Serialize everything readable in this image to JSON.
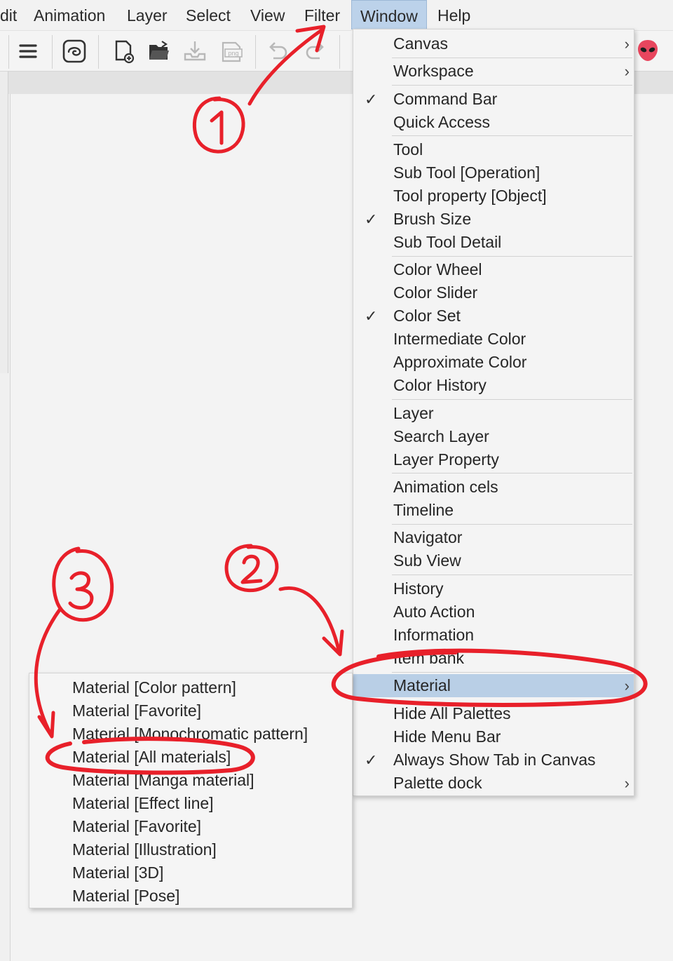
{
  "menubar": {
    "items": [
      "dit",
      "Animation",
      "Layer",
      "Select",
      "View",
      "Filter",
      "Window",
      "Help"
    ],
    "active": "Window"
  },
  "toolbar": {
    "icons": [
      "hamburger-menu-icon",
      "clip-studio-logo-icon",
      "new-canvas-icon",
      "open-folder-icon",
      "save-icon",
      "export-png-icon",
      "undo-icon",
      "redo-icon"
    ],
    "png_label": "png"
  },
  "window_menu": {
    "items": [
      {
        "label": "Canvas",
        "checked": false,
        "submenu": true
      },
      {
        "label": "Workspace",
        "checked": false,
        "submenu": true
      },
      {
        "label": "Command Bar",
        "checked": true,
        "submenu": false
      },
      {
        "label": "Quick Access",
        "checked": false,
        "submenu": false
      },
      {
        "label": "Tool",
        "checked": false,
        "submenu": false
      },
      {
        "label": "Sub Tool [Operation]",
        "checked": false,
        "submenu": false
      },
      {
        "label": "Tool property [Object]",
        "checked": false,
        "submenu": false
      },
      {
        "label": "Brush Size",
        "checked": true,
        "submenu": false
      },
      {
        "label": "Sub Tool Detail",
        "checked": false,
        "submenu": false
      },
      {
        "label": "Color Wheel",
        "checked": false,
        "submenu": false
      },
      {
        "label": "Color Slider",
        "checked": false,
        "submenu": false
      },
      {
        "label": "Color Set",
        "checked": true,
        "submenu": false
      },
      {
        "label": "Intermediate Color",
        "checked": false,
        "submenu": false
      },
      {
        "label": "Approximate Color",
        "checked": false,
        "submenu": false
      },
      {
        "label": "Color History",
        "checked": false,
        "submenu": false
      },
      {
        "label": "Layer",
        "checked": false,
        "submenu": false
      },
      {
        "label": "Search Layer",
        "checked": false,
        "submenu": false
      },
      {
        "label": "Layer Property",
        "checked": false,
        "submenu": false
      },
      {
        "label": "Animation cels",
        "checked": false,
        "submenu": false
      },
      {
        "label": "Timeline",
        "checked": false,
        "submenu": false
      },
      {
        "label": "Navigator",
        "checked": false,
        "submenu": false
      },
      {
        "label": "Sub View",
        "checked": false,
        "submenu": false
      },
      {
        "label": "History",
        "checked": false,
        "submenu": false
      },
      {
        "label": "Auto Action",
        "checked": false,
        "submenu": false
      },
      {
        "label": "Information",
        "checked": false,
        "submenu": false
      },
      {
        "label": "Item bank",
        "checked": false,
        "submenu": false
      },
      {
        "label": "Material",
        "checked": false,
        "submenu": true,
        "highlighted": true
      },
      {
        "label": "Hide All Palettes",
        "checked": false,
        "submenu": false
      },
      {
        "label": "Hide Menu Bar",
        "checked": false,
        "submenu": false
      },
      {
        "label": "Always Show Tab in Canvas",
        "checked": true,
        "submenu": false
      },
      {
        "label": "Palette dock",
        "checked": false,
        "submenu": true
      }
    ],
    "check_glyph": "✓",
    "submenu_glyph": "›"
  },
  "material_submenu": {
    "items": [
      "Material [Color pattern]",
      "Material [Favorite]",
      "Material [Monochromatic pattern]",
      "Material [All materials]",
      "Material [Manga material]",
      "Material [Effect line]",
      "Material [Favorite]",
      "Material [Illustration]",
      "Material [3D]",
      "Material [Pose]"
    ]
  },
  "annotations": {
    "color": "#e8202a",
    "step_labels": [
      "1",
      "2",
      "3"
    ]
  }
}
